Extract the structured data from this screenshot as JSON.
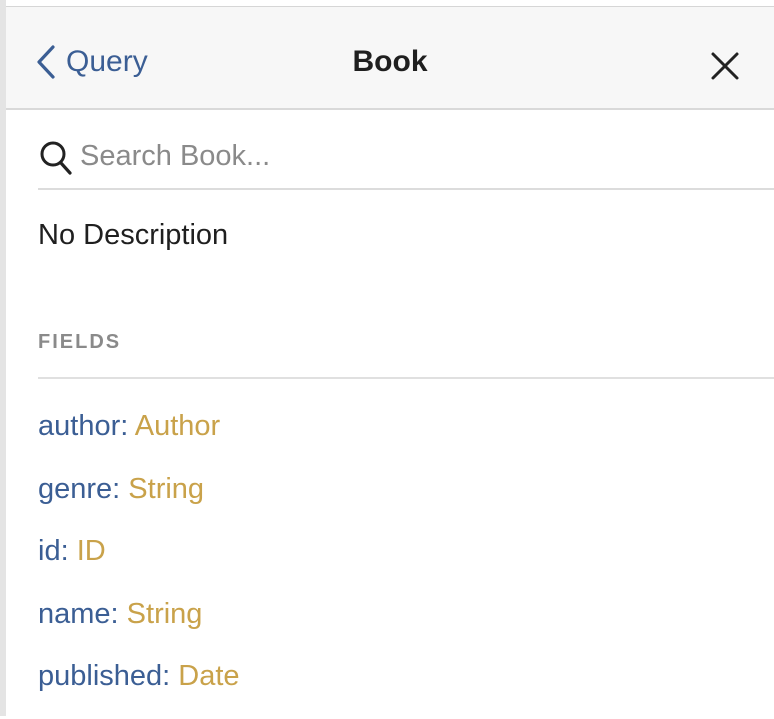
{
  "header": {
    "back_label": "Query",
    "title": "Book"
  },
  "search": {
    "placeholder": "Search Book..."
  },
  "description": "No Description",
  "fields_section": {
    "title": "FIELDS",
    "items": [
      {
        "name": "author",
        "type": "Author"
      },
      {
        "name": "genre",
        "type": "String"
      },
      {
        "name": "id",
        "type": "ID"
      },
      {
        "name": "name",
        "type": "String"
      },
      {
        "name": "published",
        "type": "Date"
      }
    ]
  },
  "colors": {
    "field_name": "#3b5e94",
    "field_type": "#c9a24a",
    "section_title": "#8a8a8a"
  }
}
